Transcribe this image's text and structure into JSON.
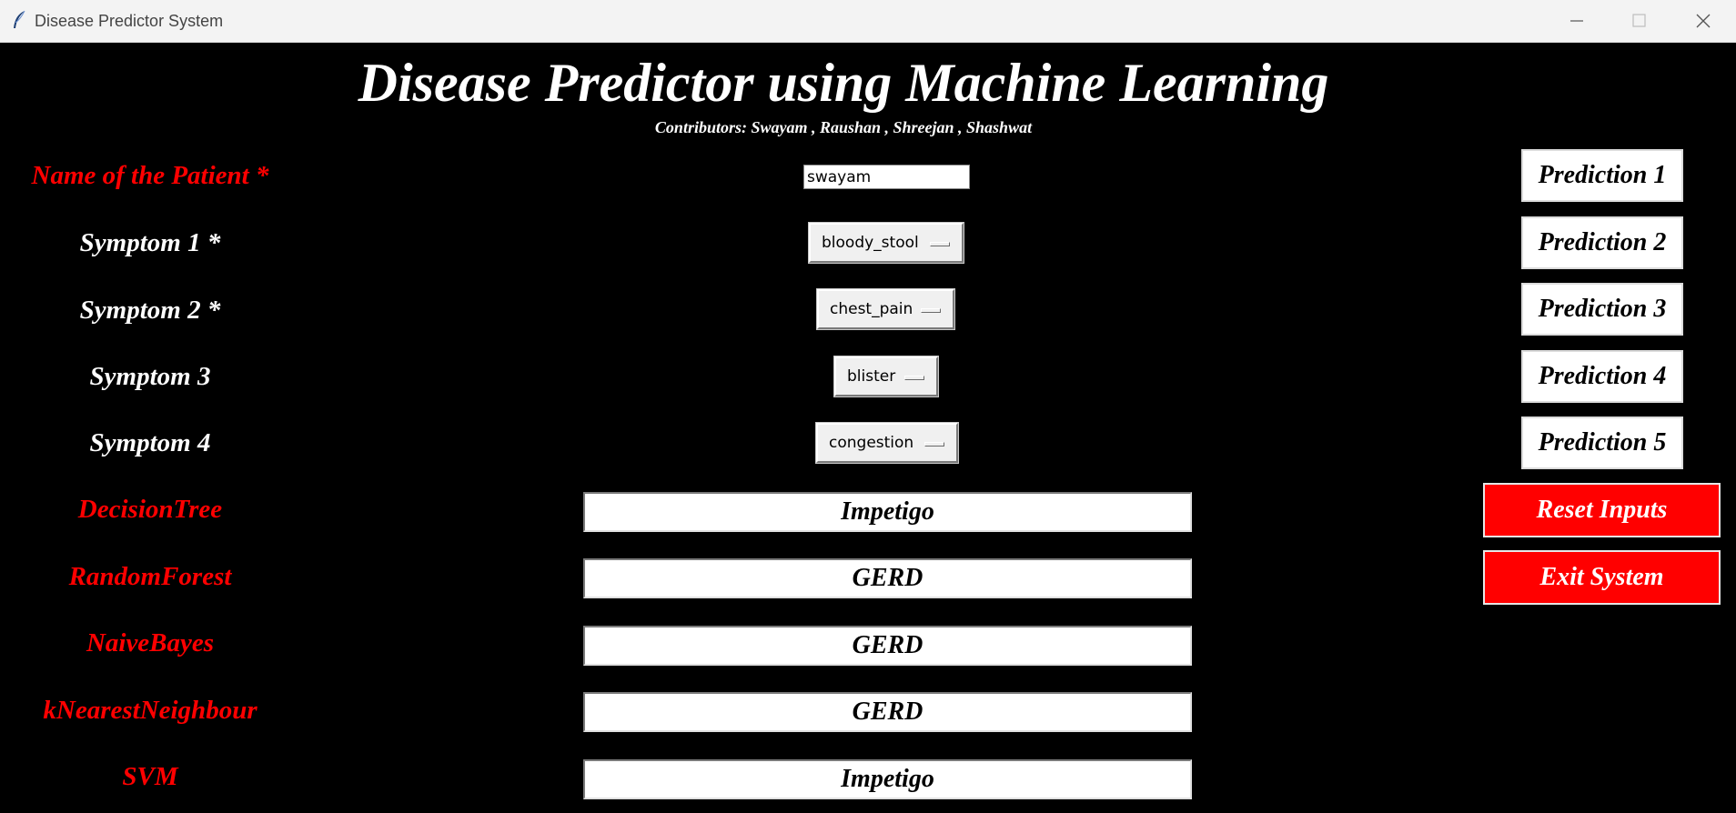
{
  "window": {
    "title": "Disease Predictor System",
    "icon": "feather-icon"
  },
  "header": {
    "title": "Disease Predictor using Machine Learning",
    "contributors": "Contributors: Swayam , Raushan , Shreejan , Shashwat"
  },
  "patient": {
    "label": "Name of the Patient *",
    "value": "swayam"
  },
  "symptoms": [
    {
      "label": "Symptom 1 *",
      "value": "bloody_stool"
    },
    {
      "label": "Symptom 2 *",
      "value": "chest_pain"
    },
    {
      "label": "Symptom 3",
      "value": "blister"
    },
    {
      "label": "Symptom 4",
      "value": "congestion"
    }
  ],
  "models": [
    {
      "label": "DecisionTree",
      "result": "Impetigo"
    },
    {
      "label": "RandomForest",
      "result": "GERD"
    },
    {
      "label": "NaiveBayes",
      "result": "GERD"
    },
    {
      "label": "kNearestNeighbour",
      "result": "GERD"
    },
    {
      "label": "SVM",
      "result": "Impetigo"
    }
  ],
  "buttons": {
    "prediction": [
      "Prediction 1",
      "Prediction 2",
      "Prediction 3",
      "Prediction 4",
      "Prediction 5"
    ],
    "reset": "Reset Inputs",
    "exit": "Exit System"
  },
  "colors": {
    "background": "#000000",
    "label_red": "#ff0000",
    "button_red": "#ff0000",
    "text_white": "#ffffff"
  }
}
